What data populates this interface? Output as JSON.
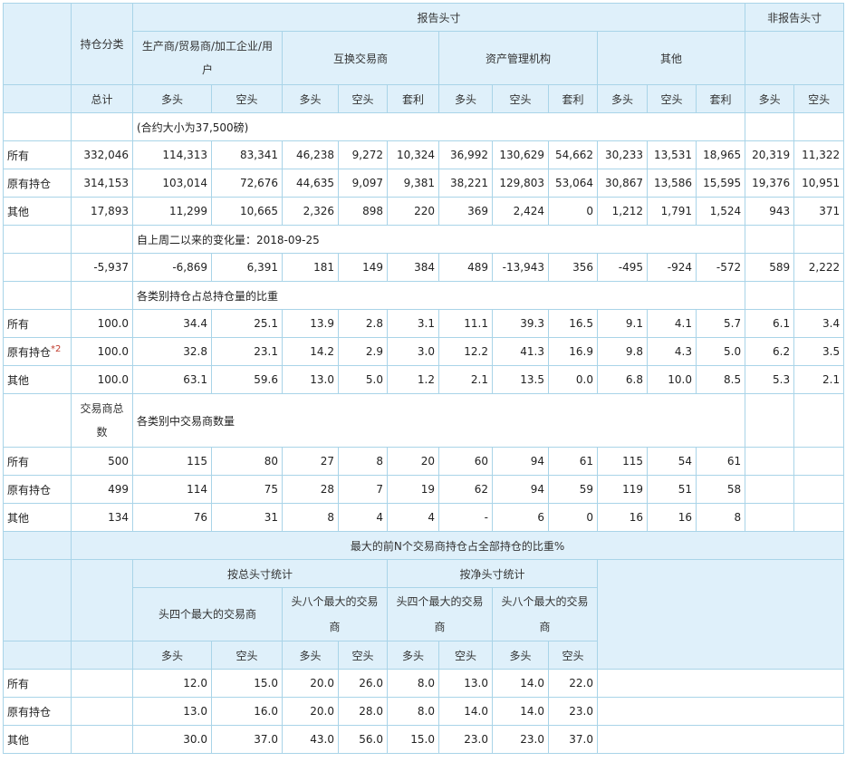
{
  "headers": {
    "reportable": "报告头寸",
    "nonreportable": "非报告头寸",
    "holding_class": "持仓分类",
    "producer": "生产商/贸易商/加工企业/用户",
    "swap": "互换交易商",
    "managed": "资产管理机构",
    "other": "其他",
    "total": "总计",
    "long": "多头",
    "short": "空头",
    "spread": "套利"
  },
  "contract_note": "(合约大小为37,500磅)",
  "change_note": "自上周二以来的变化量：2018-09-25",
  "pct_note": "各类别持仓占总持仓量的比重",
  "traders_header": "交易商总数",
  "traders_note": "各类别中交易商数量",
  "footnote_mark": "*2",
  "positions": [
    {
      "label": "所有",
      "v": [
        "332,046",
        "114,313",
        "83,341",
        "46,238",
        "9,272",
        "10,324",
        "36,992",
        "130,629",
        "54,662",
        "30,233",
        "13,531",
        "18,965",
        "20,319",
        "11,322"
      ]
    },
    {
      "label": "原有持仓",
      "v": [
        "314,153",
        "103,014",
        "72,676",
        "44,635",
        "9,097",
        "9,381",
        "38,221",
        "129,803",
        "53,064",
        "30,867",
        "13,586",
        "15,595",
        "19,376",
        "10,951"
      ]
    },
    {
      "label": "其他",
      "v": [
        "17,893",
        "11,299",
        "10,665",
        "2,326",
        "898",
        "220",
        "369",
        "2,424",
        "0",
        "1,212",
        "1,791",
        "1,524",
        "943",
        "371"
      ]
    }
  ],
  "changes": [
    "-5,937",
    "-6,869",
    "6,391",
    "181",
    "149",
    "384",
    "489",
    "-13,943",
    "356",
    "-495",
    "-924",
    "-572",
    "589",
    "2,222"
  ],
  "percents": [
    {
      "label": "所有",
      "v": [
        "100.0",
        "34.4",
        "25.1",
        "13.9",
        "2.8",
        "3.1",
        "11.1",
        "39.3",
        "16.5",
        "9.1",
        "4.1",
        "5.7",
        "6.1",
        "3.4"
      ]
    },
    {
      "label": "原有持仓",
      "v": [
        "100.0",
        "32.8",
        "23.1",
        "14.2",
        "2.9",
        "3.0",
        "12.2",
        "41.3",
        "16.9",
        "9.8",
        "4.3",
        "5.0",
        "6.2",
        "3.5"
      ]
    },
    {
      "label": "其他",
      "v": [
        "100.0",
        "63.1",
        "59.6",
        "13.0",
        "5.0",
        "1.2",
        "2.1",
        "13.5",
        "0.0",
        "6.8",
        "10.0",
        "8.5",
        "5.3",
        "2.1"
      ]
    }
  ],
  "traders": [
    {
      "label": "所有",
      "v": [
        "500",
        "115",
        "80",
        "27",
        "8",
        "20",
        "60",
        "94",
        "61",
        "115",
        "54",
        "61"
      ]
    },
    {
      "label": "原有持仓",
      "v": [
        "499",
        "114",
        "75",
        "28",
        "7",
        "19",
        "62",
        "94",
        "59",
        "119",
        "51",
        "58"
      ]
    },
    {
      "label": "其他",
      "v": [
        "134",
        "76",
        "31",
        "8",
        "4",
        "4",
        "-",
        "6",
        "0",
        "16",
        "16",
        "8"
      ]
    }
  ],
  "concentration": {
    "title": "最大的前N个交易商持仓占全部持仓的比重%",
    "gross": "按总头寸统计",
    "net": "按净头寸统计",
    "top4": "头四个最大的交易商",
    "top8": "头八个最大的交易商",
    "rows": [
      {
        "label": "所有",
        "v": [
          "12.0",
          "15.0",
          "20.0",
          "26.0",
          "8.0",
          "13.0",
          "14.0",
          "22.0"
        ]
      },
      {
        "label": "原有持仓",
        "v": [
          "13.0",
          "16.0",
          "20.0",
          "28.0",
          "8.0",
          "14.0",
          "14.0",
          "23.0"
        ]
      },
      {
        "label": "其他",
        "v": [
          "30.0",
          "37.0",
          "43.0",
          "56.0",
          "15.0",
          "23.0",
          "23.0",
          "37.0"
        ]
      }
    ]
  }
}
